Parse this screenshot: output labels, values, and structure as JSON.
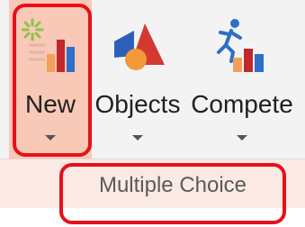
{
  "ribbon": {
    "buttons": [
      {
        "label": "New",
        "icon": "new-chart-icon",
        "selected": true
      },
      {
        "label": "Objects",
        "icon": "shapes-icon",
        "selected": false
      },
      {
        "label": "Compete",
        "icon": "runner-chart-icon",
        "selected": false
      }
    ]
  },
  "submenu": {
    "item_label": "Multiple Choice"
  },
  "colors": {
    "highlight_border": "#e8101a",
    "selected_button_bg": "#f8c9b6",
    "submenu_bg": "#fbe9e4",
    "bar_red": "#c0282c",
    "bar_orange": "#f0a05a",
    "bar_blue": "#2e6fc7",
    "spark_green": "#8bc34a"
  }
}
